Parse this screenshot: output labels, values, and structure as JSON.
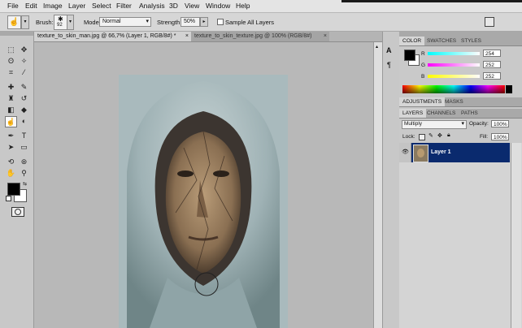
{
  "menu": [
    "File",
    "Edit",
    "Image",
    "Layer",
    "Select",
    "Filter",
    "Analysis",
    "3D",
    "View",
    "Window",
    "Help"
  ],
  "options": {
    "brush_label": "Brush:",
    "brush_size": "92",
    "mode_label": "Mode:",
    "mode_value": "Normal",
    "strength_label": "Strength:",
    "strength_value": "50%",
    "sample_label": "Sample All Layers"
  },
  "tabs": [
    {
      "label": "texture_to_skin_man.jpg @ 66,7% (Layer 1, RGB/8#) *",
      "close": "×"
    },
    {
      "label": "texture_to_skin_texture.jpg @ 100% (RGB/8#)",
      "close": "×"
    }
  ],
  "color_panel": {
    "tabs": [
      "COLOR",
      "SWATCHES",
      "STYLES"
    ],
    "r_label": "R",
    "g_label": "G",
    "b_label": "B",
    "r_value": "254",
    "g_value": "252",
    "b_value": "252"
  },
  "adjust_panel": {
    "tabs": [
      "ADJUSTMENTS",
      "MASKS"
    ]
  },
  "layers_panel": {
    "tabs": [
      "LAYERS",
      "CHANNELS",
      "PATHS"
    ],
    "blend_mode": "Multiply",
    "opacity_label": "Opacity:",
    "opacity_value": "100%",
    "lock_label": "Lock:",
    "fill_label": "Fill:",
    "fill_value": "100%",
    "layer_name": "Layer 1"
  },
  "colors": {
    "accent_layer_selected": "#0a2a6e"
  },
  "icons": [
    "smudge-tool-icon",
    "marquee-icon",
    "move-icon",
    "lasso-icon",
    "magic-wand-icon",
    "crop-icon",
    "eyedropper-icon",
    "heal-icon",
    "brush-icon",
    "stamp-icon",
    "history-brush-icon",
    "eraser-icon",
    "bucket-icon",
    "smudge-icon",
    "dodge-icon",
    "pen-icon",
    "type-icon",
    "path-select-icon",
    "shape-icon",
    "3d-rotate-icon",
    "3d-orbit-icon",
    "hand-icon",
    "zoom-icon",
    "quick-mask-icon",
    "eye-icon"
  ]
}
